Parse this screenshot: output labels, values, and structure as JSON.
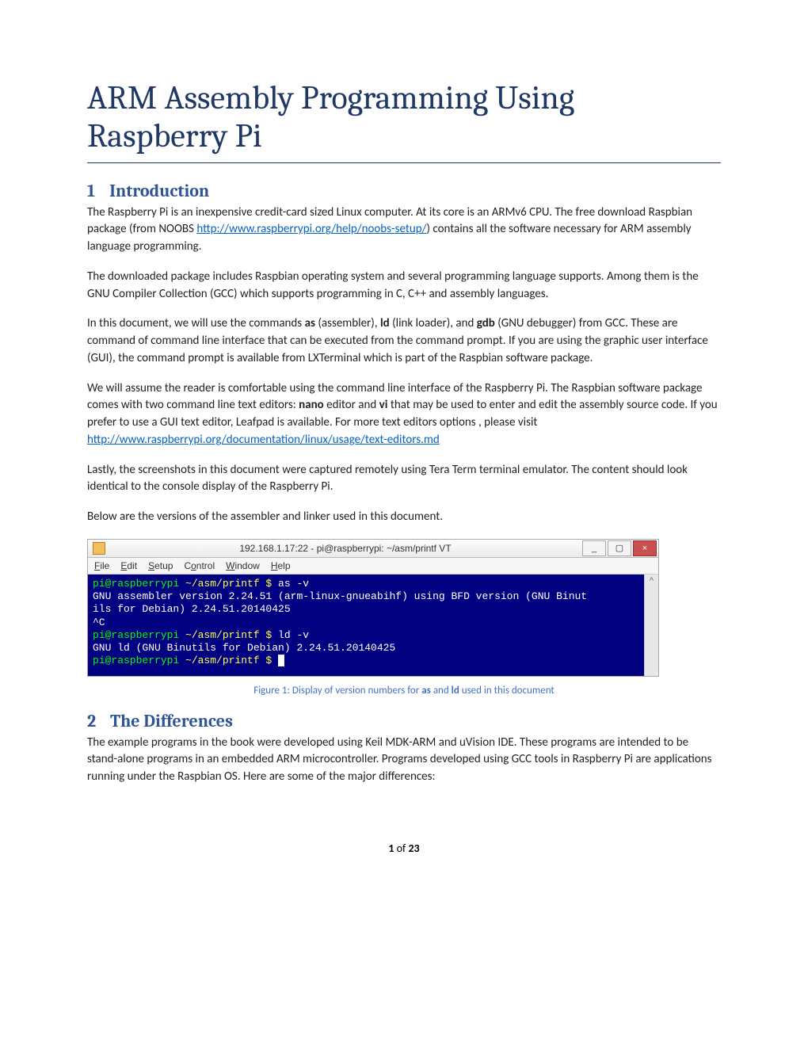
{
  "title": "ARM Assembly Programming Using Raspberry Pi",
  "sections": {
    "s1": {
      "num": "1",
      "heading": "Introduction"
    },
    "s2": {
      "num": "2",
      "heading": "The Differences"
    }
  },
  "paragraphs": {
    "p1a": "The Raspberry Pi is an inexpensive credit-card sized Linux computer. At its core is an ARMv6 CPU. The free download Raspbian package (from NOOBS ",
    "p1_link1": "http://www.raspberrypi.org/help/noobs-setup/",
    "p1b": ") contains all the software necessary for ARM assembly language programming.",
    "p2": "The downloaded package includes Raspbian operating system and several programming language supports. Among them is the GNU Compiler Collection (GCC) which supports programming in C, C++ and assembly languages.",
    "p3a": "In this document, we will use the commands ",
    "p3_as": "as",
    "p3b": " (assembler), ",
    "p3_ld": "ld",
    "p3c": " (link loader), and ",
    "p3_gdb": "gdb",
    "p3d": " (GNU debugger) from GCC. These are command of command line interface that can be executed from the command prompt. If you are using the graphic user interface (GUI), the command prompt is available from LXTerminal which is part of the Raspbian software package.",
    "p4a": "We will assume the reader is comfortable using the command line interface of the Raspberry Pi. The Raspbian software package comes with two command line text editors: ",
    "p4_nano": "nano",
    "p4b": " editor and ",
    "p4_vi": "vi",
    "p4c": " that may be used to enter and edit the assembly source code. If you prefer to use a GUI text editor, Leafpad is available. For more text editors options , please visit",
    "p4_link": "http://www.raspberrypi.org/documentation/linux/usage/text-editors.md",
    "p5": "Lastly, the screenshots in this document were captured remotely using Tera Term terminal emulator. The content should look identical to the console display of the Raspberry Pi.",
    "p6": "Below are the versions of the assembler and linker used in this document.",
    "p7": "The example programs in the book were developed using Keil MDK-ARM and uVision IDE. These programs are intended to be stand-alone programs in an embedded ARM microcontroller. Programs developed using GCC tools in Raspberry Pi are applications running under the Raspbian OS. Here are some of the major differences:"
  },
  "terminal": {
    "title": "192.168.1.17:22 - pi@raspberrypi: ~/asm/printf VT",
    "menu": {
      "file": "File",
      "edit": "Edit",
      "setup": "Setup",
      "control": "Control",
      "window": "Window",
      "help": "Help"
    },
    "buttons": {
      "min": "_",
      "max": "▢",
      "close": "×"
    },
    "scroll_up": "^",
    "lines": {
      "l1_prompt_user": "pi@raspberrypi",
      "l1_prompt_path": " ~/asm/printf $ ",
      "l1_cmd": "as -v",
      "l2": "GNU assembler version 2.24.51 (arm-linux-gnueabihf) using BFD version (GNU Binut",
      "l3": "ils for Debian) 2.24.51.20140425",
      "l4": "^C",
      "l5_prompt_user": "pi@raspberrypi",
      "l5_prompt_path": " ~/asm/printf $ ",
      "l5_cmd": "ld -v",
      "l6": "GNU ld (GNU Binutils for Debian) 2.24.51.20140425",
      "l7_prompt_user": "pi@raspberrypi",
      "l7_prompt_path": " ~/asm/printf $ ",
      "l7_cursor": "█"
    }
  },
  "figure_caption": {
    "pre": "Figure 1: Display of version numbers for ",
    "b1": "as",
    "mid": " and ",
    "b2": "ld",
    "post": " used in this document"
  },
  "footer": {
    "page": "1",
    "of_word": " of ",
    "total": "23"
  }
}
